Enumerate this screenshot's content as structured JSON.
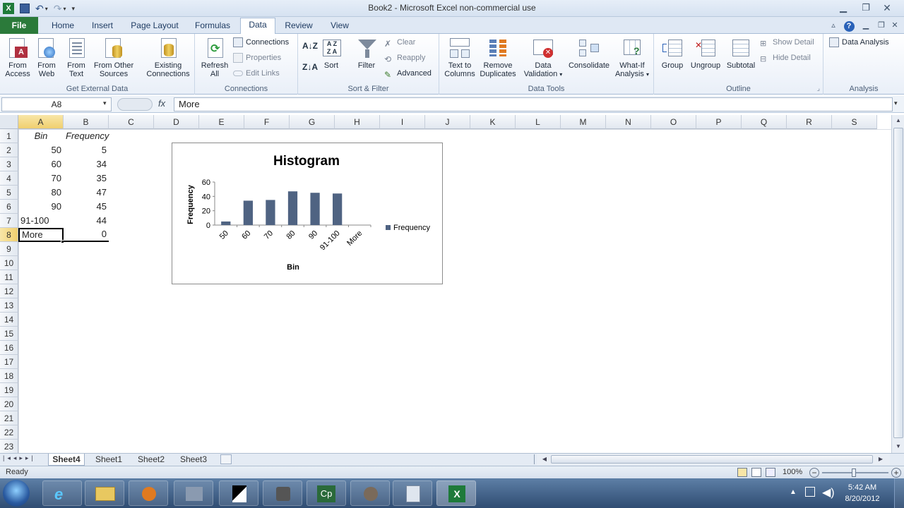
{
  "window": {
    "title": "Book2 - Microsoft Excel non-commercial use"
  },
  "tabs": [
    {
      "label": "File"
    },
    {
      "label": "Home"
    },
    {
      "label": "Insert"
    },
    {
      "label": "Page Layout"
    },
    {
      "label": "Formulas"
    },
    {
      "label": "Data"
    },
    {
      "label": "Review"
    },
    {
      "label": "View"
    }
  ],
  "ribbon": {
    "get_external_data": {
      "label": "Get External Data",
      "from_access": "From Access",
      "from_web": "From Web",
      "from_text": "From Text",
      "from_other": "From Other Sources",
      "existing": "Existing Connections"
    },
    "connections": {
      "label": "Connections",
      "refresh_all": "Refresh All",
      "connections": "Connections",
      "properties": "Properties",
      "edit_links": "Edit Links"
    },
    "sort_filter": {
      "label": "Sort & Filter",
      "sort": "Sort",
      "filter": "Filter",
      "clear": "Clear",
      "reapply": "Reapply",
      "advanced": "Advanced"
    },
    "data_tools": {
      "label": "Data Tools",
      "text_to_columns": "Text to Columns",
      "remove_duplicates": "Remove Duplicates",
      "data_validation": "Data Validation",
      "consolidate": "Consolidate",
      "what_if": "What-If Analysis"
    },
    "outline": {
      "label": "Outline",
      "group": "Group",
      "ungroup": "Ungroup",
      "subtotal": "Subtotal",
      "show_detail": "Show Detail",
      "hide_detail": "Hide Detail"
    },
    "analysis": {
      "label": "Analysis",
      "data_analysis": "Data Analysis"
    }
  },
  "formula_bar": {
    "name_box": "A8",
    "fx": "fx",
    "value": "More"
  },
  "columns": [
    "A",
    "B",
    "C",
    "D",
    "E",
    "F",
    "G",
    "H",
    "I",
    "J",
    "K",
    "L",
    "M",
    "N",
    "O",
    "P",
    "Q",
    "R",
    "S"
  ],
  "rows": [
    "1",
    "2",
    "3",
    "4",
    "5",
    "6",
    "7",
    "8",
    "9",
    "10",
    "11",
    "12",
    "13",
    "14",
    "15",
    "16",
    "17",
    "18",
    "19",
    "20",
    "21",
    "22",
    "23"
  ],
  "sheet": {
    "A1": "Bin",
    "B1": "Frequency",
    "A2": "50",
    "B2": "5",
    "A3": "60",
    "B3": "34",
    "A4": "70",
    "B4": "35",
    "A5": "80",
    "B5": "47",
    "A6": "90",
    "B6": "45",
    "A7": "91-100",
    "B7": "44",
    "A8": "More",
    "B8": "0"
  },
  "chart_data": {
    "type": "bar",
    "title": "Histogram",
    "xlabel": "Bin",
    "ylabel": "Frequency",
    "categories": [
      "50",
      "60",
      "70",
      "80",
      "90",
      "91-100",
      "More"
    ],
    "series": [
      {
        "name": "Frequency",
        "values": [
          5,
          34,
          35,
          47,
          45,
          44,
          0
        ],
        "color": "#4f6382"
      }
    ],
    "ylim": [
      0,
      60
    ],
    "yticks": [
      "0",
      "20",
      "40",
      "60"
    ],
    "legend": "right",
    "grid": false
  },
  "sheet_tabs": [
    {
      "label": "Sheet4"
    },
    {
      "label": "Sheet1"
    },
    {
      "label": "Sheet2"
    },
    {
      "label": "Sheet3"
    }
  ],
  "status": {
    "ready": "Ready",
    "zoom": "100%"
  },
  "taskbar": {
    "time": "5:42 AM",
    "date": "8/20/2012"
  },
  "colors": {
    "file_tab": "#2b7a3a",
    "chart_bar": "#4f6382",
    "selection": "#000000"
  }
}
